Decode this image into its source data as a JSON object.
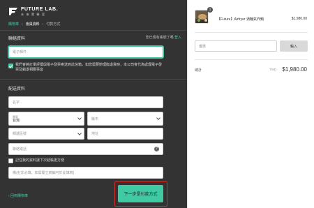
{
  "brand": {
    "name": "FUTURE LAB.",
    "tagline": "未 來 實 驗 室"
  },
  "breadcrumb": {
    "cart": "購物車",
    "member": "會員資料",
    "payment": "付款方式",
    "separator": "›"
  },
  "contact": {
    "title": "聯絡資料",
    "login_prompt": "您已經有帳號了嗎",
    "login_link": "登入",
    "email_placeholder": "電子郵件"
  },
  "consent": {
    "text": "我們會將訂單評價與電子發票寄送到此信箱，如您需要辦理換退貨時，本公司會代為處理電子發票及銷退相關事宜",
    "checked": true
  },
  "shipping": {
    "title": "配送資料",
    "name_placeholder": "名字",
    "country_label": "國家",
    "country_value": "台灣",
    "city_placeholder": "縣市",
    "postal_placeholder": "郵遞區號",
    "address_placeholder": "地址",
    "phone_placeholder": "聯絡電話",
    "help_symbol": "?",
    "save_label": "記住我的資料讓下次結帳更方便",
    "save_checked": false,
    "note_placeholder": "備註(非必填，如需開立統編可於此填寫)"
  },
  "footer": {
    "back_label": "‹ 回到購物車",
    "next_label": "下一步是付款方式"
  },
  "summary": {
    "quantity": "1",
    "product_name": "【Future】Airfryer 渦輪氣炸鍋",
    "product_price": "$1,980.00",
    "coupon_placeholder": "優惠",
    "apply_label": "輸入",
    "total_label": "總計",
    "currency": "TWD",
    "total_value": "$1,980.00"
  },
  "colors": {
    "accent": "#45c7a4",
    "panel": "#333333",
    "highlight_border": "#d32f2f"
  },
  "icons": [
    "future-lab-logo-icon",
    "checkbox-checked-icon",
    "chevron-down-icon",
    "help-icon",
    "product-thumbnail"
  ]
}
